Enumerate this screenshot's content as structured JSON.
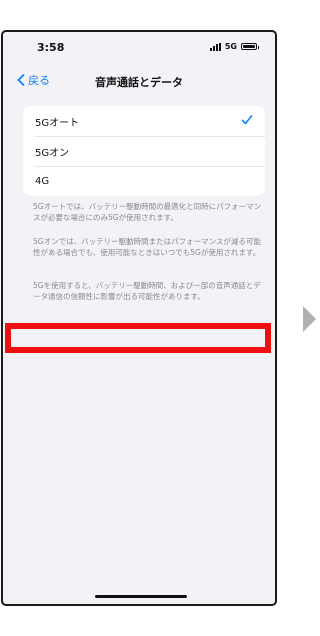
{
  "status_bar": {
    "time": "3:58",
    "network": "5G",
    "battery_level": 1.0
  },
  "nav": {
    "back_label": "戻る",
    "title": "音声通話とデータ"
  },
  "options": [
    {
      "label": "5Gオート",
      "selected": true
    },
    {
      "label": "5Gオン",
      "selected": false
    },
    {
      "label": "4G",
      "selected": false
    }
  ],
  "footer": [
    "5Gオートでは、バッテリー駆動時間の最適化と同時にパフォーマンスが必要な場合にのみ5Gが使用されます。",
    "5Gオンでは、バッテリー駆動時間またはパフォーマンスが減る可能性がある場合でも、使用可能なときはいつでも5Gが使用されます。",
    "5Gを使用すると、バッテリー駆動時間、および一部の音声通話とデータ通信の信頼性に影響が出る可能性があります。"
  ],
  "colors": {
    "accent": "#0a84ff",
    "highlight": "#ee1111",
    "background": "#f2f2f7"
  },
  "icons": {
    "back": "chevron-left-icon",
    "check": "checkmark-icon",
    "next": "arrow-right-icon"
  }
}
